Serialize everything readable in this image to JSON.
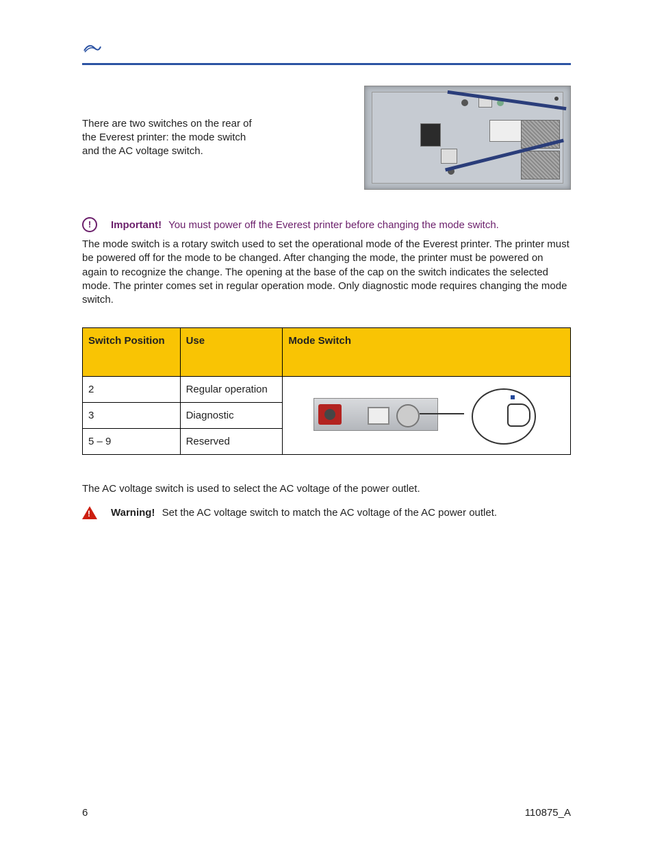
{
  "intro": "There are two switches on the rear of the Everest printer: the mode switch and the AC voltage switch.",
  "mode_switch": {
    "important_label": "Important!",
    "important_text": "You must power off the Everest printer before changing the mode switch.",
    "description": "The mode switch is a rotary switch used to set the operational mode of the Everest printer. The printer must be powered off for the mode to be changed. After changing the mode, the printer must be powered on again to recognize the change. The opening at the base of the cap on the switch indicates the selected mode. The printer comes set in regular operation mode. Only diagnostic mode requires changing the mode switch.",
    "table": {
      "headers": [
        "Switch Position",
        "Use",
        "Mode Switch"
      ],
      "rows": [
        {
          "pos": "2",
          "use": "Regular operation"
        },
        {
          "pos": "3",
          "use": "Diagnostic"
        },
        {
          "pos": "5 – 9",
          "use": "Reserved"
        }
      ]
    }
  },
  "ac_voltage": {
    "description": "The AC voltage switch is used to select the AC voltage of the power outlet.",
    "warning_label": "Warning!",
    "warning_text": "Set the AC voltage switch to match the AC voltage of the AC power outlet."
  },
  "footer": {
    "page": "6",
    "doc": "110875_A"
  }
}
